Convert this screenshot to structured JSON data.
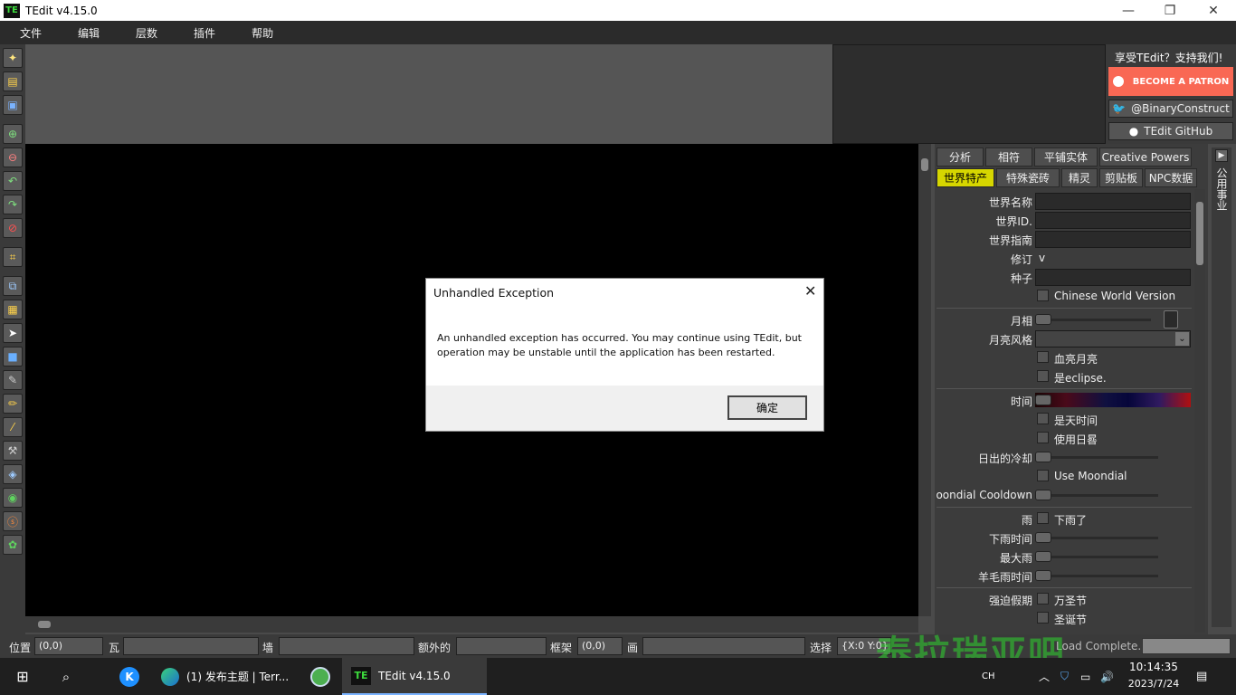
{
  "window": {
    "title": "TEdit v4.15.0",
    "logo": "TE"
  },
  "menu": [
    "文件",
    "编辑",
    "层数",
    "插件",
    "帮助"
  ],
  "sponsor": {
    "promo": "享受TEdit？支持我们!",
    "patreon": "BECOME A PATRON",
    "twitter": "@BinaryConstruct",
    "github": "TEdit GitHub"
  },
  "tabs": {
    "row1": [
      "分析",
      "相符",
      "平铺实体",
      "Creative Powers"
    ],
    "row2": [
      "世界特产",
      "特殊瓷砖",
      "精灵",
      "剪贴板",
      "NPC数据"
    ],
    "active": "世界特产"
  },
  "side_tab": "公用事业",
  "properties": {
    "world_name": "世界名称",
    "world_id": "世界ID.",
    "world_guide": "世界指南",
    "revision": "修订",
    "revision_value": "v",
    "seed": "种子",
    "chinese_version": "Chinese World Version",
    "moon_phase": "月相",
    "moon_style": "月亮风格",
    "blood_moon": "血亮月亮",
    "eclipse": "是eclipse.",
    "time": "时间",
    "is_day": "是天时间",
    "use_sundial": "使用日晷",
    "sundial_cooldown": "日出的冷却",
    "use_moondial": "Use Moondial",
    "moondial_cooldown": "oondial Cooldown",
    "rain": "雨",
    "raining": "下雨了",
    "rain_time": "下雨时间",
    "max_rain": "最大雨",
    "wool_rain_time": "羊毛雨时间",
    "forced_holiday": "强迫假期",
    "halloween": "万圣节",
    "christmas": "圣诞节"
  },
  "status": {
    "position_label": "位置",
    "position_value": "(0,0)",
    "tile_label": "瓦",
    "wall_label": "墙",
    "extra_label": "额外的",
    "frame_label": "框架",
    "frame_value": "(0,0)",
    "paint_label": "画",
    "select_label": "选择",
    "select_value": "{X:0 Y:0}",
    "load_status": "Load Complete."
  },
  "watermark": "泰拉瑞亚吧",
  "taskbar": {
    "edge_label": "(1) 发布主题 | Terr...",
    "tedit_label": "TEdit v4.15.0",
    "lang": "CH",
    "time": "10:14:35",
    "date": "2023/7/24"
  },
  "dialog": {
    "title": "Unhandled Exception",
    "message": "An unhandled exception has occurred. You may continue using TEdit, but operation may be unstable until the application has been restarted.",
    "ok": "确定"
  }
}
